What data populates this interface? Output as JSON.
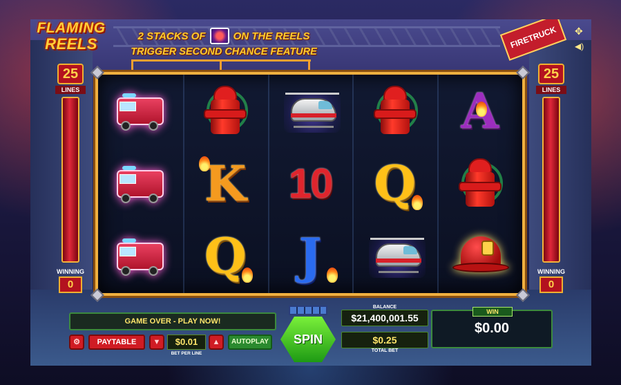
{
  "logo": {
    "line1": "FLAMING",
    "line2": "REELS"
  },
  "promo": {
    "line1_a": "2 STACKS OF",
    "line1_b": "ON THE REELS",
    "line2": "TRIGGER SECOND CHANCE FEATURE"
  },
  "sign": "FIRETRUCK",
  "meters": {
    "left": {
      "lines": "25",
      "lines_label": "LINES",
      "winning_label": "WINNING",
      "winning": "0"
    },
    "right": {
      "lines": "25",
      "lines_label": "LINES",
      "winning_label": "WINNING",
      "winning": "0"
    }
  },
  "reels": [
    [
      "fire-truck",
      "fire-truck",
      "fire-truck"
    ],
    [
      "fire-hydrant",
      "K",
      "Q"
    ],
    [
      "helicopter",
      "10",
      "J"
    ],
    [
      "fire-hydrant",
      "Q",
      "helicopter"
    ],
    [
      "A",
      "fire-hydrant",
      "fire-helmet"
    ]
  ],
  "labels": {
    "K": "K",
    "Q": "Q",
    "J": "J",
    "A": "A",
    "10": "10"
  },
  "controls": {
    "message": "GAME OVER - PLAY NOW!",
    "paytable": "PAYTABLE",
    "bet_per_line": "$0.01",
    "bet_per_line_label": "BET PER LINE",
    "autoplay": "AUTOPLAY",
    "spin": "SPIN",
    "balance_label": "BALANCE",
    "balance": "$21,400,001.55",
    "total_bet": "$0.25",
    "total_bet_label": "TOTAL BET",
    "win_label": "WIN",
    "win": "$0.00"
  },
  "colors": {
    "accent": "#f0b040",
    "spin_green": "#3ccf22",
    "red": "#d01c24"
  }
}
